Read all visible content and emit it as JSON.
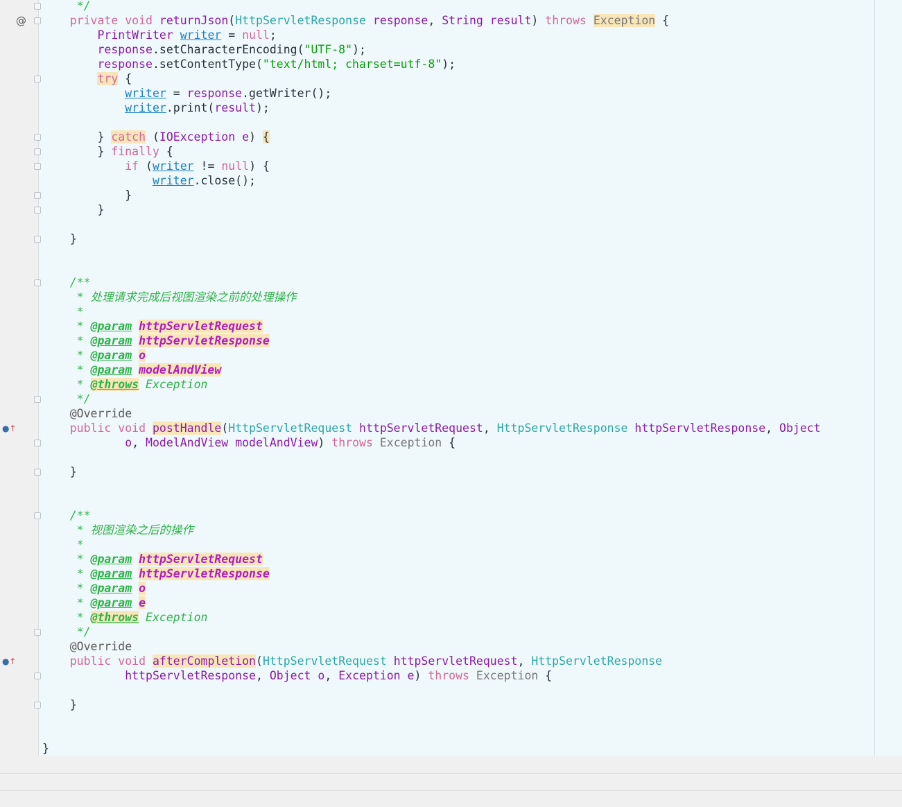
{
  "colors": {
    "keyword": "#d0679b",
    "declaration": "#8b1aa8",
    "type": "#2aa6a8",
    "string": "#0a9e0a",
    "field": "#1a7fc4",
    "comment": "#2fb24a",
    "doctag": "#2fb24a",
    "docparam": "#b01dbf",
    "annotation": "#5a5a5a",
    "plain": "#263238",
    "highlight_bg": "#f8e6b8",
    "muted": "#777777"
  },
  "gutter_icons": [
    {
      "name": "at-sign-icon",
      "glyph": "@",
      "row": 1
    },
    {
      "name": "implements-icon-1",
      "glyph": "●↑",
      "row": 29
    },
    {
      "name": "implements-icon-2",
      "glyph": "●↑",
      "row": 45
    }
  ],
  "code_lines": [
    [
      {
        "t": "     */",
        "c": "comment"
      }
    ],
    [
      {
        "t": "    "
      },
      {
        "t": "private",
        "c": "keyword"
      },
      {
        "t": " "
      },
      {
        "t": "void",
        "c": "keyword"
      },
      {
        "t": " "
      },
      {
        "t": "returnJson",
        "c": "declaration"
      },
      {
        "t": "("
      },
      {
        "t": "HttpServletResponse",
        "c": "type"
      },
      {
        "t": " "
      },
      {
        "t": "response",
        "c": "declaration"
      },
      {
        "t": ", "
      },
      {
        "t": "String",
        "c": "declaration"
      },
      {
        "t": " "
      },
      {
        "t": "result",
        "c": "declaration"
      },
      {
        "t": ") "
      },
      {
        "t": "throws",
        "c": "keyword"
      },
      {
        "t": " "
      },
      {
        "t": "Exception",
        "c": "muted",
        "hl": true
      },
      {
        "t": " {"
      }
    ],
    [
      {
        "t": "        "
      },
      {
        "t": "PrintWriter",
        "c": "declaration"
      },
      {
        "t": " "
      },
      {
        "t": "writer",
        "c": "field",
        "u": true
      },
      {
        "t": " = "
      },
      {
        "t": "null",
        "c": "keyword"
      },
      {
        "t": ";"
      }
    ],
    [
      {
        "t": "        "
      },
      {
        "t": "response",
        "c": "declaration"
      },
      {
        "t": ".setCharacterEncoding("
      },
      {
        "t": "\"UTF-8\"",
        "c": "string"
      },
      {
        "t": ");"
      }
    ],
    [
      {
        "t": "        "
      },
      {
        "t": "response",
        "c": "declaration"
      },
      {
        "t": ".setContentType("
      },
      {
        "t": "\"text/html; charset=utf-8\"",
        "c": "string"
      },
      {
        "t": ");"
      }
    ],
    [
      {
        "t": "        "
      },
      {
        "t": "try",
        "c": "keyword",
        "hl": true
      },
      {
        "t": " {"
      }
    ],
    [
      {
        "t": "            "
      },
      {
        "t": "writer",
        "c": "field",
        "u": true
      },
      {
        "t": " = "
      },
      {
        "t": "response",
        "c": "declaration"
      },
      {
        "t": ".getWriter();"
      }
    ],
    [
      {
        "t": "            "
      },
      {
        "t": "writer",
        "c": "field",
        "u": true
      },
      {
        "t": ".print("
      },
      {
        "t": "result",
        "c": "declaration"
      },
      {
        "t": ");"
      }
    ],
    [
      {
        "t": ""
      }
    ],
    [
      {
        "t": "        } "
      },
      {
        "t": "catch",
        "c": "keyword",
        "hl": true
      },
      {
        "t": " ("
      },
      {
        "t": "IOException",
        "c": "declaration"
      },
      {
        "t": " "
      },
      {
        "t": "e",
        "c": "declaration"
      },
      {
        "t": ") "
      },
      {
        "t": "{",
        "hl": true
      }
    ],
    [
      {
        "t": "        } "
      },
      {
        "t": "finally",
        "c": "keyword"
      },
      {
        "t": " {"
      }
    ],
    [
      {
        "t": "            "
      },
      {
        "t": "if",
        "c": "keyword"
      },
      {
        "t": " ("
      },
      {
        "t": "writer",
        "c": "field",
        "u": true
      },
      {
        "t": " != "
      },
      {
        "t": "null",
        "c": "keyword"
      },
      {
        "t": ") {"
      }
    ],
    [
      {
        "t": "                "
      },
      {
        "t": "writer",
        "c": "field",
        "u": true
      },
      {
        "t": ".close();"
      }
    ],
    [
      {
        "t": "            }"
      }
    ],
    [
      {
        "t": "        }"
      }
    ],
    [
      {
        "t": ""
      }
    ],
    [
      {
        "t": "    }"
      }
    ],
    [
      {
        "t": ""
      }
    ],
    [
      {
        "t": ""
      }
    ],
    [
      {
        "t": "    /**",
        "c": "comment"
      }
    ],
    [
      {
        "t": "     * 处理请求完成后视图渲染之前的处理操作",
        "c": "comment"
      }
    ],
    [
      {
        "t": "     *",
        "c": "comment"
      }
    ],
    [
      {
        "t": "     * ",
        "c": "comment"
      },
      {
        "t": "@param",
        "c": "doctag",
        "u": true
      },
      {
        "t": " "
      },
      {
        "t": "httpServletRequest",
        "c": "docparam",
        "hl": true
      }
    ],
    [
      {
        "t": "     * ",
        "c": "comment"
      },
      {
        "t": "@param",
        "c": "doctag",
        "u": true
      },
      {
        "t": " "
      },
      {
        "t": "httpServletResponse",
        "c": "docparam",
        "hl": true
      }
    ],
    [
      {
        "t": "     * ",
        "c": "comment"
      },
      {
        "t": "@param",
        "c": "doctag",
        "u": true
      },
      {
        "t": " "
      },
      {
        "t": "o",
        "c": "docparam",
        "hl": true
      }
    ],
    [
      {
        "t": "     * ",
        "c": "comment"
      },
      {
        "t": "@param",
        "c": "doctag",
        "u": true
      },
      {
        "t": " "
      },
      {
        "t": "modelAndView",
        "c": "docparam",
        "hl": true
      }
    ],
    [
      {
        "t": "     * ",
        "c": "comment"
      },
      {
        "t": "@throws",
        "c": "doctag",
        "u": true,
        "hl": true
      },
      {
        "t": " "
      },
      {
        "t": "Exception",
        "c": "comment"
      }
    ],
    [
      {
        "t": "     */",
        "c": "comment"
      }
    ],
    [
      {
        "t": "    "
      },
      {
        "t": "@Override",
        "c": "annotation"
      }
    ],
    [
      {
        "t": "    "
      },
      {
        "t": "public",
        "c": "keyword"
      },
      {
        "t": " "
      },
      {
        "t": "void",
        "c": "keyword"
      },
      {
        "t": " "
      },
      {
        "t": "postHandle",
        "c": "declaration",
        "hl": true
      },
      {
        "t": "("
      },
      {
        "t": "HttpServletRequest",
        "c": "type"
      },
      {
        "t": " "
      },
      {
        "t": "httpServletRequest",
        "c": "declaration"
      },
      {
        "t": ", "
      },
      {
        "t": "HttpServletResponse",
        "c": "type"
      },
      {
        "t": " "
      },
      {
        "t": "httpServletResponse",
        "c": "declaration"
      },
      {
        "t": ", "
      },
      {
        "t": "Object",
        "c": "declaration"
      }
    ],
    [
      {
        "t": "            "
      },
      {
        "t": "o",
        "c": "declaration"
      },
      {
        "t": ", "
      },
      {
        "t": "ModelAndView",
        "c": "declaration"
      },
      {
        "t": " "
      },
      {
        "t": "modelAndView",
        "c": "declaration"
      },
      {
        "t": ") "
      },
      {
        "t": "throws",
        "c": "keyword"
      },
      {
        "t": " "
      },
      {
        "t": "Exception",
        "c": "muted"
      },
      {
        "t": " {"
      }
    ],
    [
      {
        "t": ""
      }
    ],
    [
      {
        "t": "    }"
      }
    ],
    [
      {
        "t": ""
      }
    ],
    [
      {
        "t": ""
      }
    ],
    [
      {
        "t": "    /**",
        "c": "comment"
      }
    ],
    [
      {
        "t": "     * 视图渲染之后的操作",
        "c": "comment"
      }
    ],
    [
      {
        "t": "     *",
        "c": "comment"
      }
    ],
    [
      {
        "t": "     * ",
        "c": "comment"
      },
      {
        "t": "@param",
        "c": "doctag",
        "u": true
      },
      {
        "t": " "
      },
      {
        "t": "httpServletRequest",
        "c": "docparam",
        "hl": true
      }
    ],
    [
      {
        "t": "     * ",
        "c": "comment"
      },
      {
        "t": "@param",
        "c": "doctag",
        "u": true
      },
      {
        "t": " "
      },
      {
        "t": "httpServletResponse",
        "c": "docparam",
        "hl": true
      }
    ],
    [
      {
        "t": "     * ",
        "c": "comment"
      },
      {
        "t": "@param",
        "c": "doctag",
        "u": true
      },
      {
        "t": " "
      },
      {
        "t": "o",
        "c": "docparam",
        "hl": true
      }
    ],
    [
      {
        "t": "     * ",
        "c": "comment"
      },
      {
        "t": "@param",
        "c": "doctag",
        "u": true
      },
      {
        "t": " "
      },
      {
        "t": "e",
        "c": "docparam",
        "hl": true
      }
    ],
    [
      {
        "t": "     * ",
        "c": "comment"
      },
      {
        "t": "@throws",
        "c": "doctag",
        "u": true,
        "hl": true
      },
      {
        "t": " "
      },
      {
        "t": "Exception",
        "c": "comment"
      }
    ],
    [
      {
        "t": "     */",
        "c": "comment"
      }
    ],
    [
      {
        "t": "    "
      },
      {
        "t": "@Override",
        "c": "annotation"
      }
    ],
    [
      {
        "t": "    "
      },
      {
        "t": "public",
        "c": "keyword"
      },
      {
        "t": " "
      },
      {
        "t": "void",
        "c": "keyword"
      },
      {
        "t": " "
      },
      {
        "t": "afterCompletion",
        "c": "declaration",
        "hl": true
      },
      {
        "t": "("
      },
      {
        "t": "HttpServletRequest",
        "c": "type"
      },
      {
        "t": " "
      },
      {
        "t": "httpServletRequest",
        "c": "declaration"
      },
      {
        "t": ", "
      },
      {
        "t": "HttpServletResponse",
        "c": "type"
      }
    ],
    [
      {
        "t": "            "
      },
      {
        "t": "httpServletResponse",
        "c": "declaration"
      },
      {
        "t": ", "
      },
      {
        "t": "Object",
        "c": "declaration"
      },
      {
        "t": " "
      },
      {
        "t": "o",
        "c": "declaration"
      },
      {
        "t": ", "
      },
      {
        "t": "Exception",
        "c": "declaration"
      },
      {
        "t": " "
      },
      {
        "t": "e",
        "c": "declaration"
      },
      {
        "t": ") "
      },
      {
        "t": "throws",
        "c": "keyword"
      },
      {
        "t": " "
      },
      {
        "t": "Exception",
        "c": "muted"
      },
      {
        "t": " {"
      }
    ],
    [
      {
        "t": ""
      }
    ],
    [
      {
        "t": "    }"
      }
    ],
    [
      {
        "t": ""
      }
    ],
    [
      {
        "t": ""
      }
    ],
    [
      {
        "t": "}"
      }
    ]
  ],
  "fold_rows": [
    0,
    1,
    5,
    9,
    10,
    11,
    13,
    14,
    16,
    19,
    27,
    30,
    32,
    35,
    43,
    46,
    48
  ]
}
